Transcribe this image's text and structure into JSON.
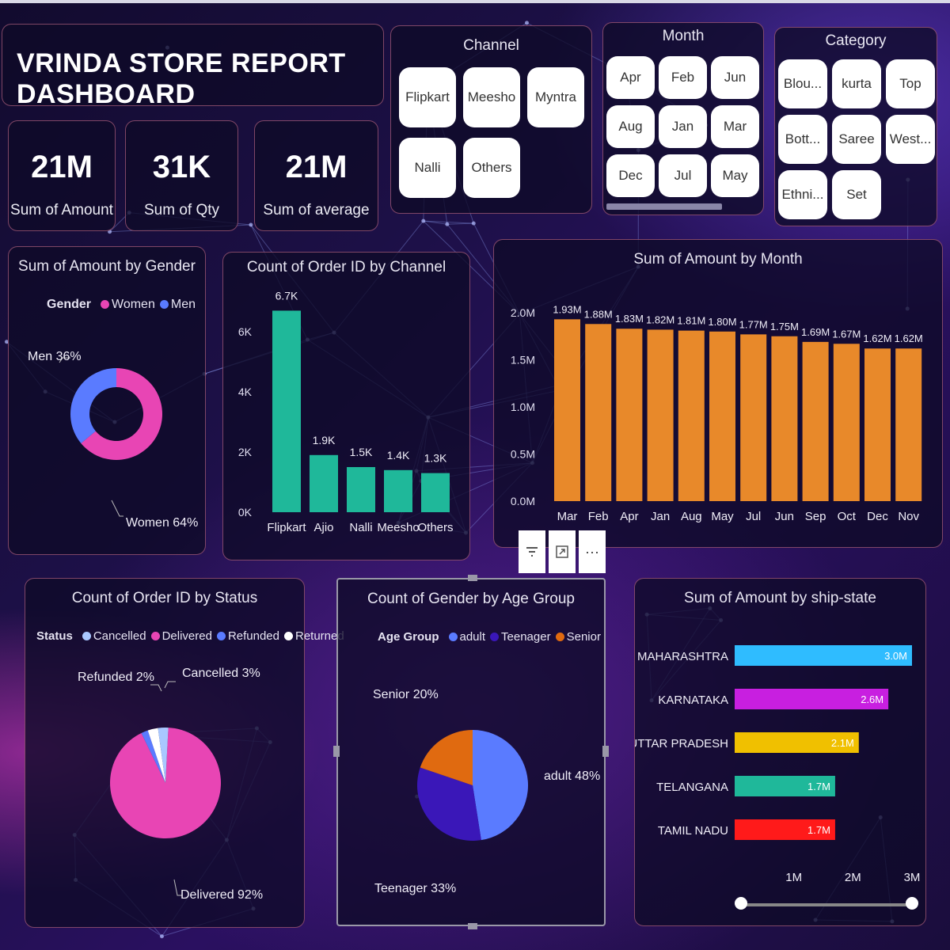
{
  "title": "VRINDA STORE REPORT DASHBOARD",
  "kpis": [
    {
      "value": "21M",
      "label": "Sum of Amount"
    },
    {
      "value": "31K",
      "label": "Sum of Qty"
    },
    {
      "value": "21M",
      "label": "Sum of average"
    }
  ],
  "slicers": {
    "channel": {
      "title": "Channel",
      "items": [
        "Flipkart",
        "Meesho",
        "Myntra",
        "Nalli",
        "Others"
      ]
    },
    "month": {
      "title": "Month",
      "items": [
        "Apr",
        "Feb",
        "Jun",
        "Aug",
        "Jan",
        "Mar",
        "Dec",
        "Jul",
        "May"
      ]
    },
    "category": {
      "title": "Category",
      "items": [
        "Blou...",
        "kurta",
        "Top",
        "Bott...",
        "Saree",
        "West...",
        "Ethni...",
        "Set"
      ]
    }
  },
  "toolbar": {
    "icons": [
      "filter-icon",
      "focus-mode-icon",
      "more-options-icon"
    ],
    "more": "···"
  },
  "colors": {
    "teal": "#1fb89a",
    "orange": "#e8892a",
    "women": "#e845b4",
    "men": "#5a7bff",
    "adult": "#5a7bff",
    "teenager": "#3a17b8",
    "senior": "#e06a10"
  },
  "chart_data": [
    {
      "id": "gender",
      "type": "pie",
      "title": "Sum of Amount by Gender",
      "legend_title": "Gender",
      "categories": [
        "Women",
        "Men"
      ],
      "values": [
        64,
        36
      ],
      "labels": [
        "Women 64%",
        "Men 36%"
      ],
      "colors": [
        "#e845b4",
        "#5a7bff"
      ],
      "donut": true
    },
    {
      "id": "channel",
      "type": "bar",
      "title": "Count of Order ID by Channel",
      "categories": [
        "Flipkart",
        "Ajio",
        "Nalli",
        "Meesho",
        "Others"
      ],
      "values": [
        6700,
        1900,
        1500,
        1400,
        1300
      ],
      "data_labels": [
        "6.7K",
        "1.9K",
        "1.5K",
        "1.4K",
        "1.3K"
      ],
      "y_ticks": [
        "0K",
        "2K",
        "4K",
        "6K"
      ],
      "ylim": [
        0,
        7000
      ],
      "color": "#1fb89a"
    },
    {
      "id": "month",
      "type": "bar",
      "title": "Sum of Amount by Month",
      "categories": [
        "Mar",
        "Feb",
        "Apr",
        "Jan",
        "Aug",
        "May",
        "Jul",
        "Jun",
        "Sep",
        "Oct",
        "Dec",
        "Nov"
      ],
      "values": [
        1.93,
        1.88,
        1.83,
        1.82,
        1.81,
        1.8,
        1.77,
        1.75,
        1.69,
        1.67,
        1.62,
        1.62
      ],
      "data_labels": [
        "1.93M",
        "1.88M",
        "1.83M",
        "1.82M",
        "1.81M",
        "1.80M",
        "1.77M",
        "1.75M",
        "1.69M",
        "1.67M",
        "1.62M",
        "1.62M"
      ],
      "y_ticks": [
        "0.0M",
        "0.5M",
        "1.0M",
        "1.5M",
        "2.0M"
      ],
      "ylim": [
        0,
        2.0
      ],
      "color": "#e8892a"
    },
    {
      "id": "status",
      "type": "pie",
      "title": "Count of Order ID by Status",
      "legend_title": "Status",
      "categories": [
        "Cancelled",
        "Delivered",
        "Refunded",
        "Returned"
      ],
      "values": [
        3,
        92,
        2,
        3
      ],
      "labels": [
        "Cancelled 3%",
        "Delivered 92%",
        "Refunded 2%"
      ],
      "colors": [
        "#a9c8ff",
        "#e845b4",
        "#5a7bff",
        "#ffffff"
      ]
    },
    {
      "id": "age",
      "type": "pie",
      "title": "Count of Gender by Age Group",
      "legend_title": "Age Group",
      "categories": [
        "adult",
        "Teenager",
        "Senior"
      ],
      "values": [
        48,
        33,
        20
      ],
      "labels": [
        "adult 48%",
        "Teenager 33%",
        "Senior 20%"
      ],
      "colors": [
        "#5a7bff",
        "#3a17b8",
        "#e06a10"
      ]
    },
    {
      "id": "state",
      "type": "bar",
      "orientation": "horizontal",
      "title": "Sum of Amount by ship-state",
      "categories": [
        "MAHARASHTRA",
        "KARNATAKA",
        "UTTAR PRADESH",
        "TELANGANA",
        "TAMIL NADU"
      ],
      "values": [
        3.0,
        2.6,
        2.1,
        1.7,
        1.7
      ],
      "data_labels": [
        "3.0M",
        "2.6M",
        "2.1M",
        "1.7M",
        "1.7M"
      ],
      "colors": [
        "#2fbcff",
        "#c81fe0",
        "#f0c000",
        "#1fb89a",
        "#ff1a1a"
      ],
      "x_ticks": [
        "1M",
        "2M",
        "3M"
      ],
      "xlim": [
        0,
        3.0
      ]
    }
  ]
}
